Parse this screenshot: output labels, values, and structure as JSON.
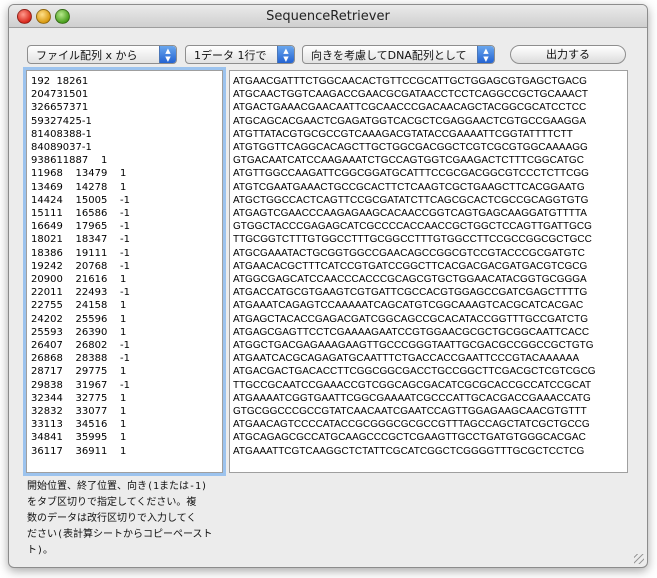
{
  "window": {
    "title": "SequenceRetriever"
  },
  "toolbar": {
    "format_popup": "ファイル配列 x から",
    "lines_popup": "1データ 1行で",
    "direction_popup": "向きを考慮してDNA配列として",
    "output_button": "出力する"
  },
  "input_text": "192  18261\n204731501\n326657371\n59327425-1\n81408388-1\n84089037-1\n938611887    1\n11968    13479    1\n13469    14278    1\n14424    15005    -1\n15111    16586    -1\n16649    17965    -1\n18021    18347    -1\n18386    19111    -1\n19242    20768    -1\n20900    21616    1\n22011    22493    -1\n22755    24158    1\n24202    25596    1\n25593    26390    1\n26407    26802    -1\n26868    28388    -1\n28717    29775    1\n29838    31967    -1\n32344    32775    1\n32832    33077    1\n33113    34516    1\n34841    35995    1\n36117    36911    1",
  "output_text": "ATGAACGATTTCTGGCAACACTGTTCCGCATTGCTGGAGCGTGAGCTGACG\nATGCAACTGGTCAAGACCGAACGCGATAACCTCCTCAGGCCGCTGCAAACT\nATGACTGAAACGAACAATTCGCAACCCGACAACAGCTACGGCGCATCCTCC\nATGCAGCACGAACTCGAGATGGTCACGCTCGAGGAACTCGTGCCGAAGGA\nATGTTATACGTGCGCCGTCAAAGACGTATACCGAAAATTCGGTATTTTCTT\nATGTGGTTCAGGCACAGCTTGCTGGCGACGGCTCGTCGCGTGGCAAAAGG\nGTGACAATCATCCAAGAAATCTGCCAGTGGTCGAAGACTCTTTCGGCATGC\nATGTTGGCCAAGATTCGGCGGATGCATTTCCGCGACGGCGTCCCTCTTCGG\nATGTCGAATGAAACTGCCGCACTTCTCAAGTCGCTGAAGCTTCACGGAATG\nATGCTGGCCACTCAGTTCCGCGATATCTTCAGCGCACTCGCCGCAGGTGTG\nATGAGTCGAACCCAAGAGAAGCACAACCGGTCAGTGAGCAAGGATGTTTTA\nGTGGCTACCCGAGAGCATCGCCCCACCAACCGCTGGCTCCAGTTGATTGCG\nTTGCGGTCTTTGTGGCCTTTGCGGCCTTTGTGGCCTTCCGCCGGCGCTGCC\nATGCGAAATACTGCGGTGGCCGAACAGCCGGCGTCCGTACCCGCGATGTC\nATGAACACGCTTTCATCCGTGATCCGGCTTCACGACGACGATGACGTCGCG\nATGGCGAGCATCCAACCCACCCGCAGCGTGCTGGAACATACGGTGCGGGA\nATGACCATGCGTGAAGTCGTGATTCGCCACGTGGAGCCGATCGAGCTTTTG\nATGAAATCAGAGTCCAAAAATCAGCATGTCGGCAAAGTCACGCATCACGAC\nATGAGCTACACCGAGACGATCGGCAGCCGCACATACCGGTTTGCCGATCTG\nATGAGCGAGTTCCTCGAAAAGAATCCGTGGAACGCGCTGCGGCAATTCACC\nATGGCTGACGAGAAAGAAGTTGCCCGGGTAATTGCGACGCCGGCCGCTGTG\nATGAATCACGCAGAGATGCAATTTCTGACCACCGAATTCCCGTACAAAAAA\nATGACGACTGACACCTTCGGCGGCGACCTGCCGGCTTCGACGCTCGTCGCG\nTTGCCGCAATCCGAAACCGTCGGCAGCGACATCGCGCACCGCCATCCGCAT\nATGAAAATCGGTGAATTCGGCGAAAATCGCCCATTGCACGACCGAAACCATG\nGTGCGGCCCGCCGTATCAACAATCGAATCCAGTTGGAGAAGCAACGTGTTT\nATGAACAGTCCCCATACCGCGGGCGCGCCGTTTAGCCAGCTATCGCTGCCG\nATGCAGAGCGCCATGCAAGCCCGCTCGAAGTTGCCTGATGTGGGCACGAC\nATGAAATTCGTCAAGGCTCTATTCGCATCGGCTCGGGGTTTGCGCTCCTCG",
  "help_text": "開始位置、終了位置、向き(1または-1)\nをタブ区切りで指定してください。複\n数のデータは改行区切りで入力してく\nださい(表計算シートからコピーペースト\nト)。"
}
